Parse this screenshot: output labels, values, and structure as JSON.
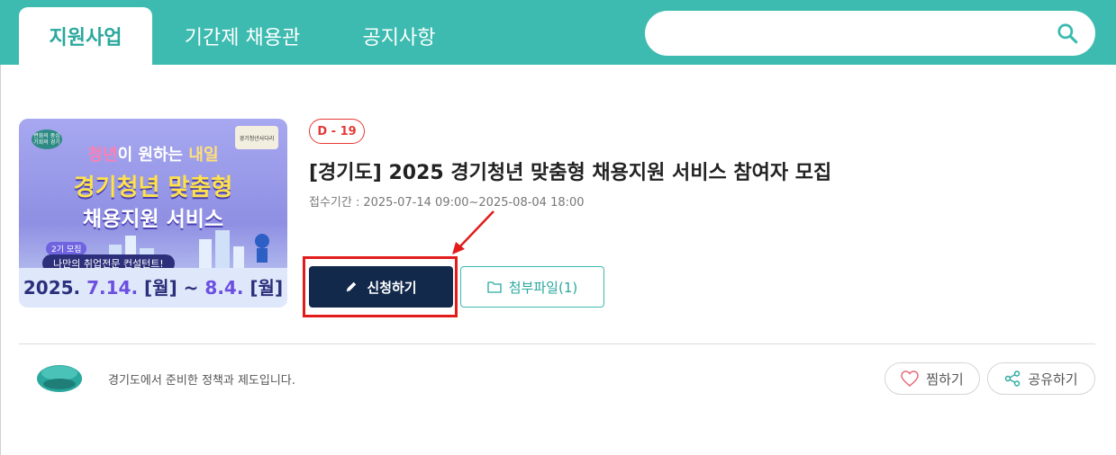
{
  "nav": {
    "tabs": [
      {
        "label": "지원사업",
        "active": true
      },
      {
        "label": "기간제 채용관",
        "active": false
      },
      {
        "label": "공지사항",
        "active": false
      }
    ],
    "search": {
      "value": "",
      "placeholder": ""
    }
  },
  "poster": {
    "badge_text": "변화의 중심 기회의 경기",
    "org_text": "경기청년사다리",
    "line1_a": "청년",
    "line1_b": "이 원하는 ",
    "line1_c": "내일",
    "line2": "경기청년 맞춤형",
    "line3": "채용지원 서비스",
    "round_label": "2기 모집",
    "pill_label": "나만의 취업전문 컨설턴트!",
    "dates_a": "2025. ",
    "dates_b": "7.14.",
    "dates_c": " [월] ~ ",
    "dates_d": "8.4.",
    "dates_e": " [월]"
  },
  "post": {
    "dday": "D - 19",
    "title": "[경기도] 2025 경기청년 맞춤형 채용지원 서비스 참여자 모집",
    "period_label": "접수기간 :",
    "period_value": "2025-07-14 09:00~2025-08-04 18:00",
    "apply_label": "신청하기",
    "attach_label": "첨부파일(1)"
  },
  "footer": {
    "logo_text": "변화의 중심 기회의 경기",
    "text": "경기도에서 준비한 정책과 제도입니다.",
    "like_label": "찜하기",
    "share_label": "공유하기"
  },
  "colors": {
    "accent": "#3dbbb0",
    "apply_button": "#13294b",
    "highlight": "#e21b1b",
    "dday": "#e53935"
  }
}
